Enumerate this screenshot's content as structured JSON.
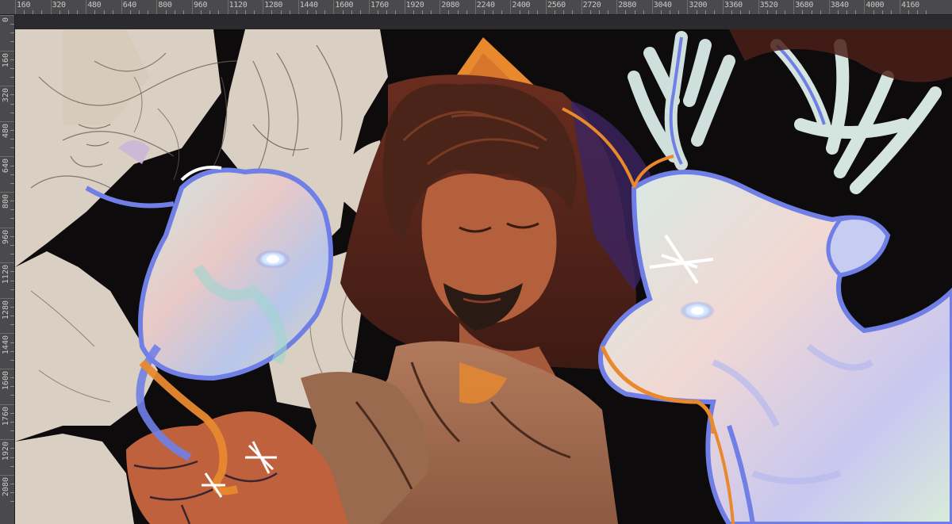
{
  "rulers": {
    "top_labels": [
      "160",
      "320",
      "480",
      "640",
      "800",
      "960",
      "1120",
      "1280",
      "1440",
      "1600",
      "1760",
      "1920",
      "2080",
      "2240",
      "2400",
      "2560",
      "2720",
      "2880",
      "3040",
      "3200",
      "3360",
      "3520",
      "3680",
      "3840",
      "4000",
      "4160"
    ],
    "left_labels": [
      "0",
      "160",
      "320",
      "480",
      "640",
      "800",
      "960",
      "1120",
      "1280",
      "1440",
      "1600",
      "1760",
      "1920",
      "2080"
    ]
  },
  "canvas": {
    "subject": "Digital painting: hooded figure with glowing pastel dragon and stag spirits"
  },
  "colors": {
    "background": "#0e0b0d",
    "sketch": "#d9cfc2",
    "cloak": "#5a2a1e",
    "skin": "#b4603c",
    "hair": "#4a2418",
    "spirit_blue": "#6f7fe6",
    "spirit_pastel": "#d9e8e2",
    "accent_orange": "#e8892e"
  }
}
